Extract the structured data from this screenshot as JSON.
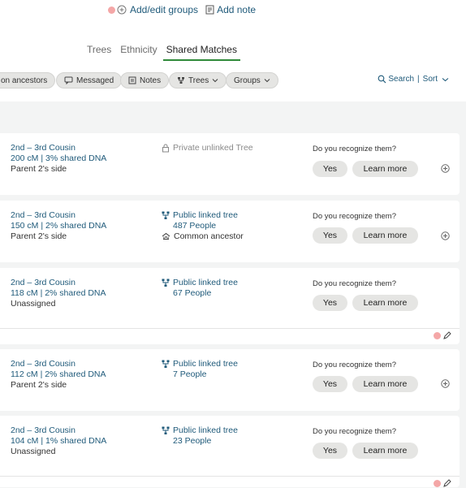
{
  "header": {
    "add_groups_label": "Add/edit groups",
    "add_note_label": "Add note"
  },
  "tabs": [
    {
      "label": "Trees",
      "active": false
    },
    {
      "label": "Ethnicity",
      "active": false
    },
    {
      "label": "Shared Matches",
      "active": true
    }
  ],
  "filters": {
    "common_ancestors_label": "on ancestors",
    "messaged_label": "Messaged",
    "notes_label": "Notes",
    "trees_label": "Trees",
    "groups_label": "Groups",
    "search_label": "Search",
    "divider": "|",
    "sort_label": "Sort"
  },
  "matches": [
    {
      "relationship": "2nd – 3rd Cousin",
      "dna": "200 cM | 3% shared DNA",
      "side": "Parent 2's side",
      "tree_type": "private",
      "tree_label": "Private unlinked Tree",
      "people": null,
      "common_ancestor": null,
      "recognize": "Do you recognize them?",
      "yes_label": "Yes",
      "learn_label": "Learn more",
      "trailing_icon": "plus-circle-icon"
    },
    {
      "relationship": "2nd – 3rd Cousin",
      "dna": "150 cM | 2% shared DNA",
      "side": "Parent 2's side",
      "tree_type": "public",
      "tree_label": "Public linked tree",
      "people": "487 People",
      "common_ancestor": "Common ancestor",
      "recognize": "Do you recognize them?",
      "yes_label": "Yes",
      "learn_label": "Learn more",
      "trailing_icon": "plus-circle-icon"
    },
    {
      "relationship": "2nd – 3rd Cousin",
      "dna": "118 cM | 2% shared DNA",
      "side": "Unassigned",
      "tree_type": "public",
      "tree_label": "Public linked tree",
      "people": "67 People",
      "common_ancestor": null,
      "recognize": "Do you recognize them?",
      "yes_label": "Yes",
      "learn_label": "Learn more",
      "trailing_icon": "pencil-icon"
    },
    {
      "relationship": "2nd – 3rd Cousin",
      "dna": "112 cM | 2% shared DNA",
      "side": "Parent 2's side",
      "tree_type": "public",
      "tree_label": "Public linked tree",
      "people": "7 People",
      "common_ancestor": null,
      "recognize": "Do you recognize them?",
      "yes_label": "Yes",
      "learn_label": "Learn more",
      "trailing_icon": "plus-circle-icon"
    },
    {
      "relationship": "2nd – 3rd Cousin",
      "dna": "104 cM | 1% shared DNA",
      "side": "Unassigned",
      "tree_type": "public",
      "tree_label": "Public linked tree",
      "people": "23 People",
      "common_ancestor": null,
      "recognize": "Do you recognize them?",
      "yes_label": "Yes",
      "learn_label": "Learn more",
      "trailing_icon": "pencil-icon"
    }
  ],
  "colors": {
    "link_blue": "#1f5a7a",
    "active_tab_underline": "#2f8a3a",
    "chip_bg": "#e5e5e3",
    "page_bg": "#f3f4f4",
    "group_dot": "#f4a7a7"
  }
}
